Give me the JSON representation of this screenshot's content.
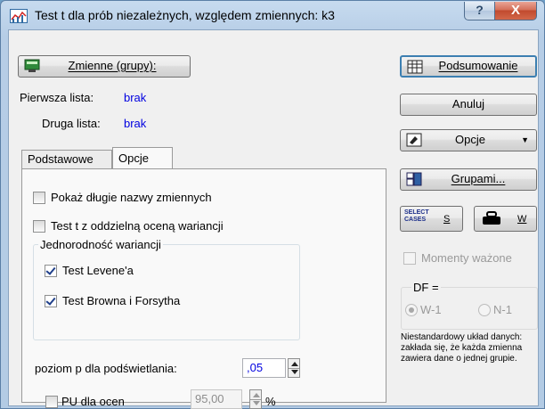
{
  "window": {
    "title": "Test t dla prób niezależnych, względem zmiennych: k3",
    "help_glyph": "?",
    "close_glyph": "X"
  },
  "left": {
    "variables_button": "Zmienne (grupy):",
    "first_list_label": "Pierwsza lista:",
    "first_list_value": "brak",
    "second_list_label": "Druga lista:",
    "second_list_value": "brak"
  },
  "tabs": [
    {
      "label": "Podstawowe"
    },
    {
      "label": "Opcje"
    }
  ],
  "options": {
    "long_names": {
      "label": "Pokaż długie nazwy zmiennych",
      "checked": false
    },
    "separate_variance": {
      "label": "Test t z oddzielną oceną wariancji",
      "checked": false
    },
    "homogeneity_group": "Jednorodność wariancji",
    "levene": {
      "label": "Test Levene'a",
      "checked": true
    },
    "brown_forsythe": {
      "label": "Test Browna i Forsytha",
      "checked": true
    },
    "p_highlight_label": "poziom p dla podświetlania:",
    "p_highlight_value": ",05",
    "ci_label": "PU dla ocen",
    "ci_value": "95,00",
    "ci_unit": "%"
  },
  "right": {
    "summary_button": "Podsumowanie",
    "cancel_button": "Anuluj",
    "options_button": "Opcje",
    "groups_button": "Grupami...",
    "select_cases_line1": "SELECT",
    "select_cases_line2": "CASES",
    "select_cases_key": "S",
    "weight_key": "W",
    "weighted_moments_label": "Momenty ważone",
    "df_label": "DF =",
    "df_w1": "W-1",
    "df_n1": "N-1",
    "note": "Niestandardowy układ danych: zakłada się, że każda zmienna zawiera dane o jednej grupie."
  },
  "colors": {
    "accent": "#3c7fb1",
    "link_blue": "#0000e0",
    "close_red": "#c14a2e"
  }
}
